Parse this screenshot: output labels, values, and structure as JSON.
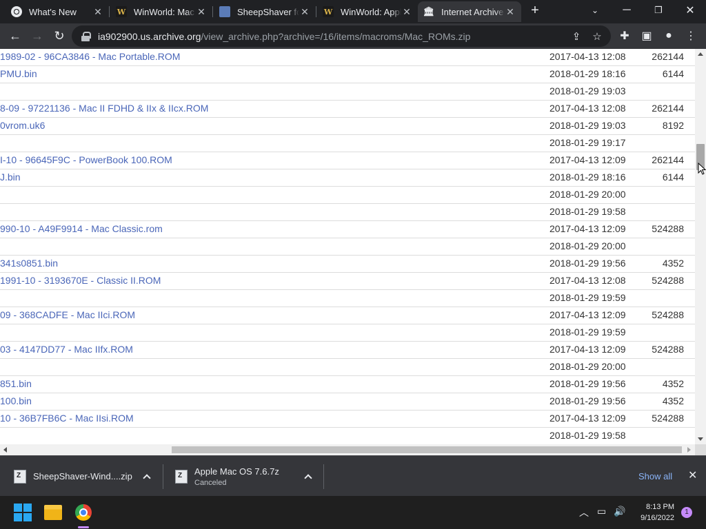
{
  "tabs": [
    {
      "title": "What's New",
      "favicon": "chrome-icon",
      "active": false
    },
    {
      "title": "WinWorld: Mac",
      "favicon": "winworld-icon",
      "active": false
    },
    {
      "title": "SheepShaver for",
      "favicon": "sheepshaver-icon",
      "active": false
    },
    {
      "title": "WinWorld: Appl",
      "favicon": "winworld-icon",
      "active": false
    },
    {
      "title": "Internet Archive",
      "favicon": "archive-icon",
      "active": true
    }
  ],
  "address": {
    "host": "ia902900.us.archive.org",
    "path": "/view_archive.php?archive=/16/items/macroms/Mac_ROMs.zip"
  },
  "files": [
    {
      "name": "1989-02 - 96CA3846 - Mac Portable.ROM",
      "date": "2017-04-13 12:08",
      "size": "262144"
    },
    {
      "name": "PMU.bin",
      "date": "2018-01-29 18:16",
      "size": "6144"
    },
    {
      "name": "",
      "date": "2018-01-29 19:03",
      "size": ""
    },
    {
      "name": "8-09 - 97221136 - Mac II FDHD & IIx & IIcx.ROM",
      "date": "2017-04-13 12:08",
      "size": "262144"
    },
    {
      "name": "0vrom.uk6",
      "date": "2018-01-29 19:03",
      "size": "8192"
    },
    {
      "name": "",
      "date": "2018-01-29 19:17",
      "size": ""
    },
    {
      "name": "I-10 - 96645F9C - PowerBook 100.ROM",
      "date": "2017-04-13 12:09",
      "size": "262144"
    },
    {
      "name": "J.bin",
      "date": "2018-01-29 18:16",
      "size": "6144"
    },
    {
      "name": "",
      "date": "2018-01-29 20:00",
      "size": ""
    },
    {
      "name": "",
      "date": "2018-01-29 19:58",
      "size": ""
    },
    {
      "name": "990-10 - A49F9914 - Mac Classic.rom",
      "date": "2017-04-13 12:09",
      "size": "524288"
    },
    {
      "name": "",
      "date": "2018-01-29 20:00",
      "size": ""
    },
    {
      "name": "341s0851.bin",
      "date": "2018-01-29 19:56",
      "size": "4352"
    },
    {
      "name": "1991-10 - 3193670E - Classic II.ROM",
      "date": "2017-04-13 12:08",
      "size": "524288"
    },
    {
      "name": "",
      "date": "2018-01-29 19:59",
      "size": ""
    },
    {
      "name": "09 - 368CADFE - Mac IIci.ROM",
      "date": "2017-04-13 12:09",
      "size": "524288"
    },
    {
      "name": "",
      "date": "2018-01-29 19:59",
      "size": ""
    },
    {
      "name": "03 - 4147DD77 - Mac IIfx.ROM",
      "date": "2017-04-13 12:09",
      "size": "524288"
    },
    {
      "name": "",
      "date": "2018-01-29 20:00",
      "size": ""
    },
    {
      "name": "851.bin",
      "date": "2018-01-29 19:56",
      "size": "4352"
    },
    {
      "name": "100.bin",
      "date": "2018-01-29 19:56",
      "size": "4352"
    },
    {
      "name": "10 - 36B7FB6C - Mac IIsi.ROM",
      "date": "2017-04-13 12:09",
      "size": "524288"
    },
    {
      "name": "",
      "date": "2018-01-29 19:58",
      "size": ""
    }
  ],
  "downloads": [
    {
      "name": "SheepShaver-Wind....zip",
      "status": ""
    },
    {
      "name": "Apple Mac OS 7.6.7z",
      "status": "Canceled"
    }
  ],
  "show_all_label": "Show all",
  "clock": {
    "time": "8:13 PM",
    "date": "9/16/2022"
  },
  "notification_count": "1",
  "colors": {
    "link": "#4a66b8",
    "accent": "#8ab4f8",
    "taskbar_active": "#c58af9"
  }
}
